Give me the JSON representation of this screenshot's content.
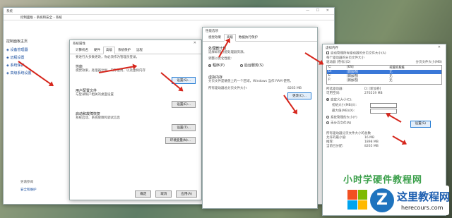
{
  "system": {
    "title": "系统",
    "breadcrumb": "控制面板 › 系统和安全 › 系统",
    "side_heading": "控制面板主页",
    "side_items": [
      "设备管理器",
      "远程设置",
      "系统保护",
      "高级系统设置"
    ],
    "see_also": "另请参阅",
    "security": "安全和维护"
  },
  "sysprops": {
    "title": "系统属性",
    "tabs": [
      "计算机名",
      "硬件",
      "高级",
      "系统保护",
      "远程"
    ],
    "admin_note": "要进行大多数更改，你必须作为管理员登录。",
    "perf_h": "性能",
    "perf_d": "视觉效果，处理器计划，内存使用，以及虚拟内存",
    "perf_btn": "设置(S)...",
    "prof_h": "用户配置文件",
    "prof_d": "与登录帐户相关的桌面设置",
    "prof_btn": "设置(E)...",
    "start_h": "启动和故障恢复",
    "start_d": "系统启动、系统故障和调试信息",
    "start_btn": "设置(T)...",
    "env_btn": "环境变量(N)...",
    "ok": "确定",
    "cancel": "取消",
    "apply": "应用(A)"
  },
  "perfopts": {
    "title": "性能选项",
    "tabs": [
      "视觉效果",
      "高级",
      "数据执行保护"
    ],
    "proc_h": "处理器计划",
    "proc_d": "选择如何分配处理器资源。",
    "optimize": "调整以优化性能:",
    "opt1": "程序(P)",
    "opt2": "后台服务(S)",
    "vm_h": "虚拟内存",
    "vm_d": "分页文件是硬盘上的一个区域，Windows 当作 RAM 使用。",
    "vm_total_label": "所有驱动器总分页文件大小:",
    "vm_total": "8265 MB",
    "change_btn": "更改(C)..."
  },
  "vmem": {
    "title": "虚拟内存",
    "auto": "自动管理所有驱动器的分页文件大小(A)",
    "per_drive": "每个驱动器的分页文件大小",
    "col_drive": "驱动器 [卷标](D)",
    "col_size": "分页文件大小(MB)",
    "drives": [
      [
        "C:",
        "[OS]",
        "托管的系统"
      ],
      [
        "D:",
        "[新加卷]",
        "无"
      ],
      [
        "E:",
        "[新加卷]",
        "无"
      ],
      [
        "F:",
        "[新加卷]",
        "无"
      ]
    ],
    "sel_drive_label": "所选驱动器:",
    "sel_drive": "D: [新加卷]",
    "space_label": "可用空间:",
    "space": "276519 MB",
    "custom": "自定义大小(C):",
    "initial": "初始大小(MB)(I):",
    "max": "最大值(MB)(X):",
    "sys_managed": "系统管理的大小(Y)",
    "none": "无分页文件(N)",
    "set_btn": "设置(S)",
    "totals_h": "所有驱动器分页文件大小的总数",
    "min_label": "允许的最小值:",
    "min": "16 MB",
    "rec_label": "推荐:",
    "rec": "1898 MB",
    "alloc_label": "当前已分配:",
    "alloc": "8265 MB"
  },
  "watermark": {
    "cn": "这里教程网",
    "en": "herecours.com",
    "overlay": "小时学硬件教程网"
  },
  "colors": {
    "arrow": "#d6261c",
    "accent": "#3a78d8"
  }
}
